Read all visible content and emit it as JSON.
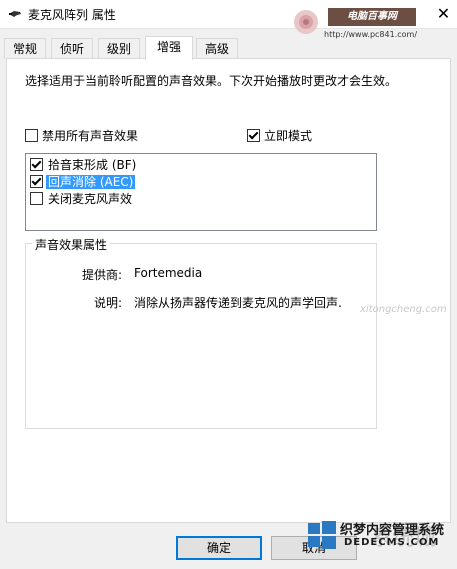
{
  "window": {
    "title": "麦克风阵列 属性",
    "close_glyph": "✕"
  },
  "tabs": [
    {
      "label": "常规",
      "active": false
    },
    {
      "label": "侦听",
      "active": false
    },
    {
      "label": "级别",
      "active": false
    },
    {
      "label": "增强",
      "active": true
    },
    {
      "label": "高级",
      "active": false
    }
  ],
  "enhancements": {
    "description": "选择适用于当前聆听配置的声音效果。下次开始播放时更改才会生效。",
    "disable_all": {
      "label": "禁用所有声音效果",
      "checked": false
    },
    "immediate_mode": {
      "label": "立即模式",
      "checked": true
    },
    "effects": [
      {
        "label": "拾音束形成 (BF)",
        "checked": true,
        "selected": false
      },
      {
        "label": "回声消除 (AEC)",
        "checked": true,
        "selected": true
      },
      {
        "label": "关闭麦克风声效",
        "checked": false,
        "selected": false
      }
    ]
  },
  "properties": {
    "group_title": "声音效果属性",
    "provider_label": "提供商:",
    "provider_value": "Fortemedia",
    "description_label": "说明:",
    "description_value": "消除从扬声器传递到麦克风的声学回声."
  },
  "buttons": {
    "ok": "确定",
    "cancel": "取消"
  },
  "watermarks": {
    "top_logo": "电脑百事网",
    "top_url": "http://www.pc841.com/",
    "mid": "xitongcheng.com",
    "bottom_line1": "织梦内容管理系统",
    "bottom_line2": "DEDECMS.COM",
    "bottom_brand": "系统城"
  },
  "colors": {
    "selection": "#3399ff",
    "default_button_border": "#0078d7",
    "window_bg": "#f0f0f0"
  }
}
